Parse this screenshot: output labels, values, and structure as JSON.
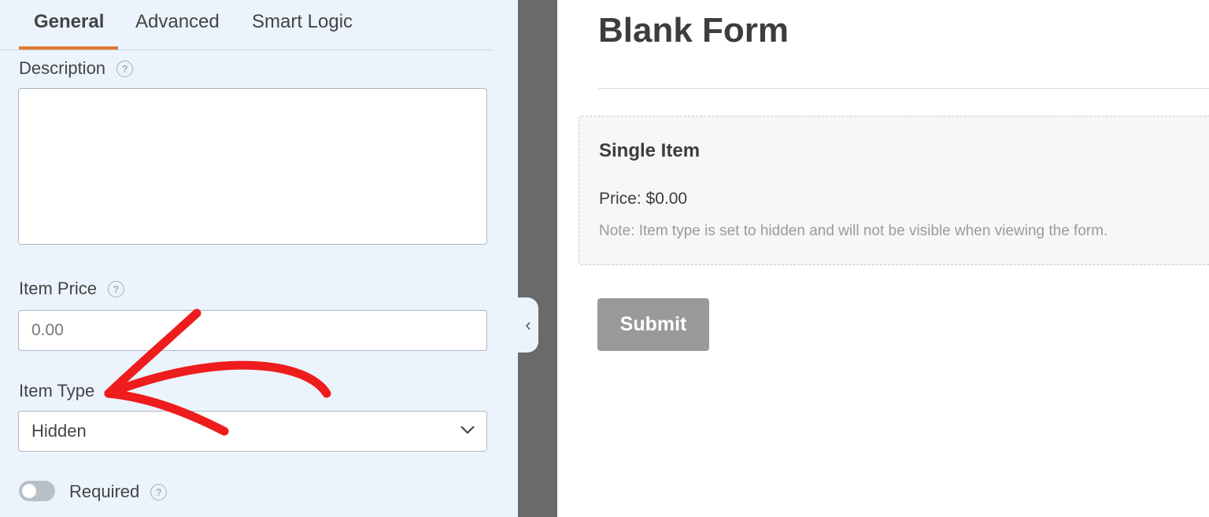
{
  "tabs": [
    {
      "label": "General",
      "active": true
    },
    {
      "label": "Advanced",
      "active": false
    },
    {
      "label": "Smart Logic",
      "active": false
    }
  ],
  "fields": {
    "description": {
      "label": "Description",
      "value": ""
    },
    "item_price": {
      "label": "Item Price",
      "placeholder": "0.00"
    },
    "item_type": {
      "label": "Item Type",
      "selected": "Hidden"
    },
    "required": {
      "label": "Required",
      "checked": false
    }
  },
  "icons": {
    "help": "?",
    "collapse": "‹"
  },
  "preview": {
    "form_title": "Blank Form",
    "field_title": "Single Item",
    "price_text": "Price: $0.00",
    "note_text": "Note: Item type is set to hidden and will not be visible when viewing the form.",
    "submit_label": "Submit"
  },
  "colors": {
    "accent": "#e27730",
    "annotation_arrow": "#ee1c1c",
    "panel_bg": "#ebf3fc"
  }
}
